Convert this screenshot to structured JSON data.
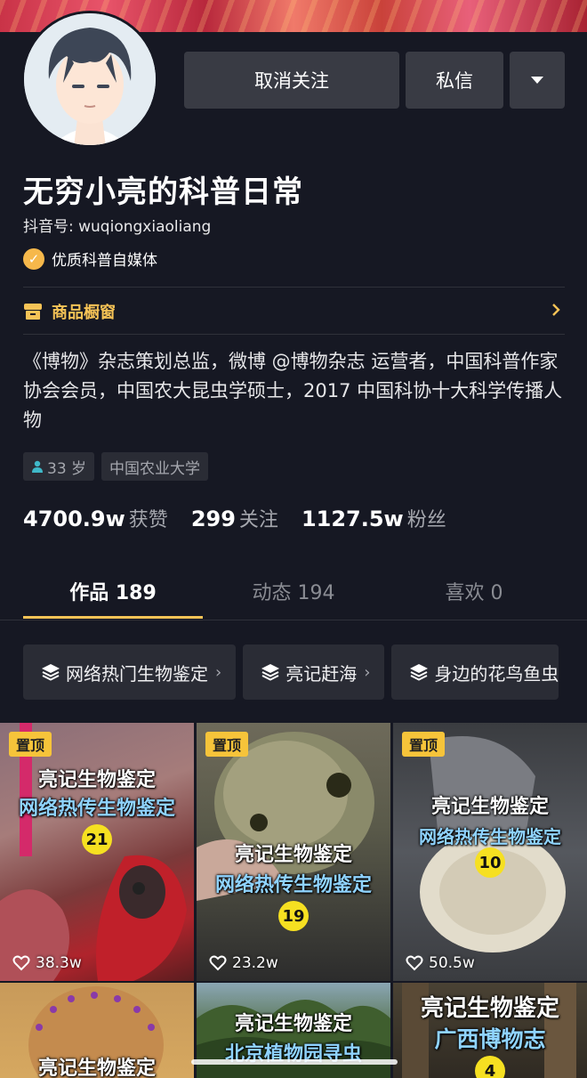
{
  "profile": {
    "name": "无穷小亮的科普日常",
    "douyin_id": "抖音号: wuqiongxiaoliang",
    "verification": "优质科普自媒体",
    "shop_label": "商品橱窗",
    "bio": "《博物》杂志策划总监，微博 @博物杂志 运营者，中国科普作家协会会员，中国农大昆虫学硕士，2017 中国科协十大科学传播人物",
    "tags": [
      "33 岁",
      "中国农业大学"
    ]
  },
  "actions": {
    "unfollow": "取消关注",
    "message": "私信"
  },
  "stats": [
    {
      "value": "4700.9w",
      "label": "获赞"
    },
    {
      "value": "299",
      "label": "关注"
    },
    {
      "value": "1127.5w",
      "label": "粉丝"
    }
  ],
  "tabs": [
    {
      "label": "作品 189",
      "active": true
    },
    {
      "label": "动态 194",
      "active": false
    },
    {
      "label": "喜欢 0",
      "active": false
    }
  ],
  "collections": [
    "网络热门生物鉴定",
    "亮记赶海",
    "身边的花鸟鱼虫"
  ],
  "videos": [
    {
      "pinned": "置顶",
      "title1": "亮记生物鉴定",
      "title2": "网络热传生物鉴定",
      "number": "21",
      "likes": "38.3w"
    },
    {
      "pinned": "置顶",
      "title1": "亮记生物鉴定",
      "title2": "网络热传生物鉴定",
      "number": "19",
      "likes": "23.2w"
    },
    {
      "pinned": "置顶",
      "title1": "亮记生物鉴定",
      "title2": "网络热传生物鉴定",
      "number": "10",
      "likes": "50.5w"
    },
    {
      "title1": "亮记生物鉴定"
    },
    {
      "title1": "亮记生物鉴定",
      "title2": "北京植物园寻虫"
    },
    {
      "title1": "亮记生物鉴定",
      "title2": "广西博物志",
      "number": "4"
    }
  ],
  "colors": {
    "background": "#161823",
    "accent": "#f6c356",
    "button": "#393b44"
  }
}
